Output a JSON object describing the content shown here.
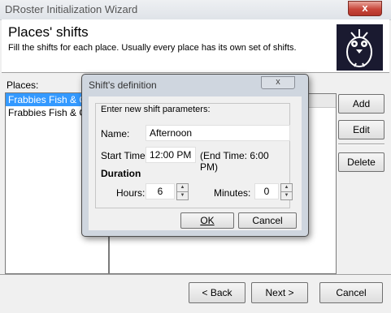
{
  "window": {
    "title": "DRoster Initialization Wizard",
    "close_glyph": "x"
  },
  "header": {
    "title": "Places' shifts",
    "subtitle": "Fill the shifts for each place. Usually every place has its own set of shifts."
  },
  "places": {
    "label": "Places:",
    "items": [
      "Frabbies Fish & Chips",
      "Frabbies Fish & Chips"
    ]
  },
  "side_buttons": {
    "add": "Add",
    "edit": "Edit",
    "delete": "Delete"
  },
  "nav": {
    "back": "< Back",
    "next": "Next >",
    "cancel": "Cancel"
  },
  "dialog": {
    "title": "Shift's definition",
    "close_glyph": "x",
    "group_label": "Enter new shift parameters:",
    "name_label": "Name:",
    "name_value": "Afternoon",
    "start_label": "Start Time:",
    "start_value": "12:00 PM",
    "end_text": "(End Time: 6:00 PM)",
    "duration_label": "Duration",
    "hours_label": "Hours:",
    "hours_value": "6",
    "minutes_label": "Minutes:",
    "minutes_value": "0",
    "ok": "OK",
    "cancel": "Cancel"
  }
}
